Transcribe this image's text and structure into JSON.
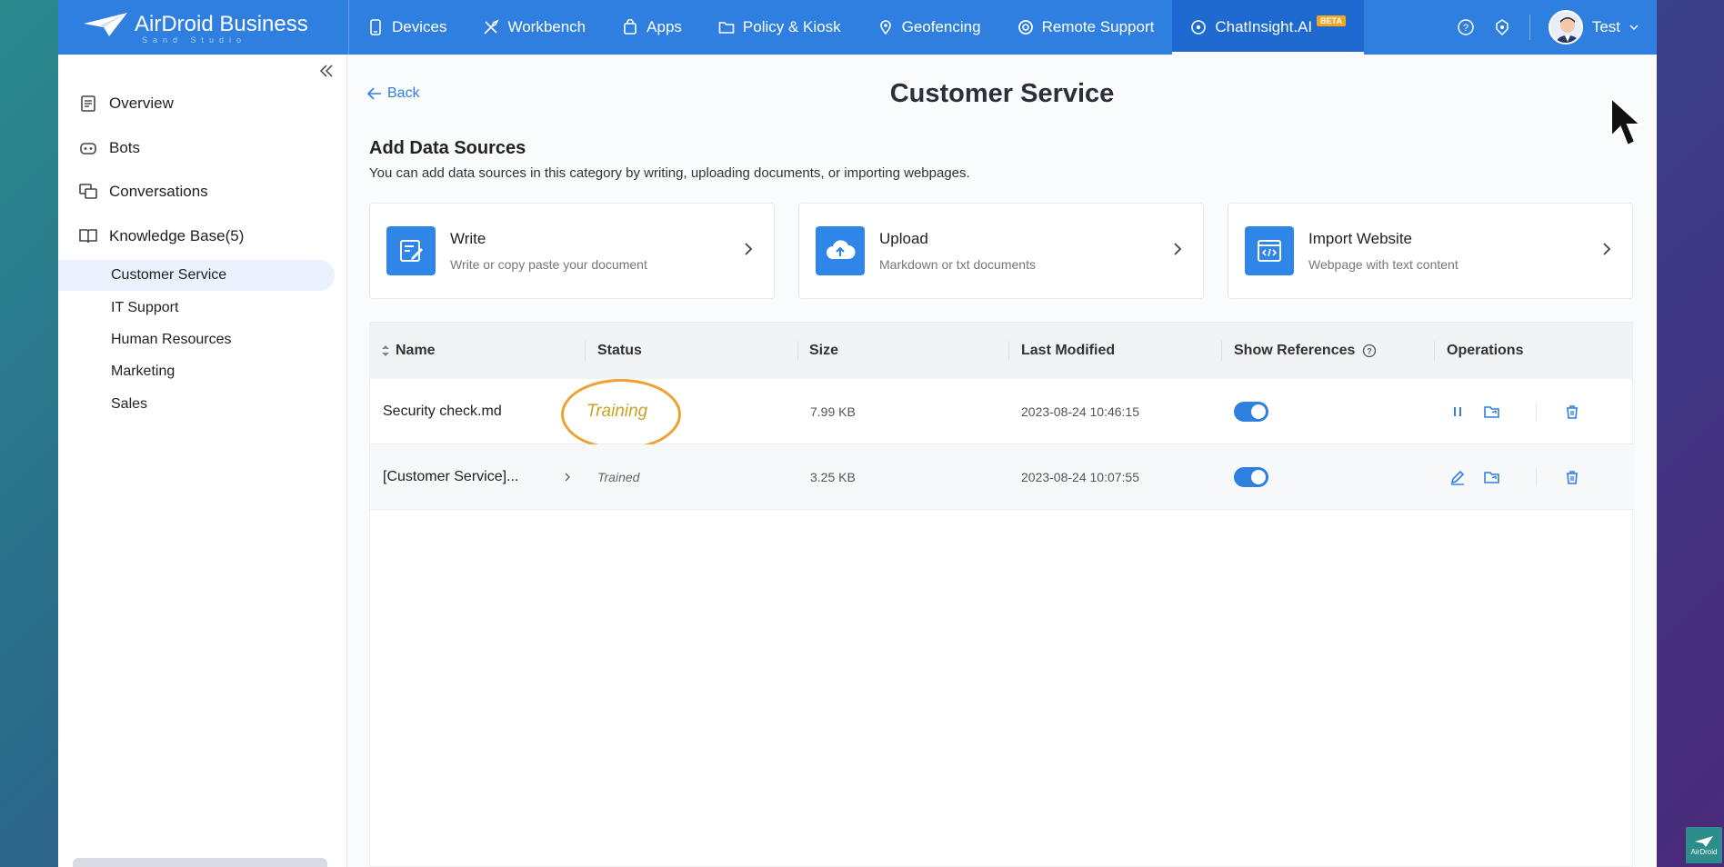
{
  "brand": {
    "name": "AirDroid Business",
    "sub": "Sand Studio"
  },
  "nav": [
    {
      "label": "Devices",
      "icon": "phone-icon"
    },
    {
      "label": "Workbench",
      "icon": "tools-icon"
    },
    {
      "label": "Apps",
      "icon": "bag-icon"
    },
    {
      "label": "Policy & Kiosk",
      "icon": "folder-icon"
    },
    {
      "label": "Geofencing",
      "icon": "map-pin-icon"
    },
    {
      "label": "Remote Support",
      "icon": "lifebuoy-icon"
    },
    {
      "label": "ChatInsight.AI",
      "icon": "chat-ai-icon",
      "badge": "BETA",
      "active": true
    }
  ],
  "user": {
    "name": "Test"
  },
  "sidebar": {
    "items": [
      {
        "label": "Overview",
        "icon": "document-icon"
      },
      {
        "label": "Bots",
        "icon": "robot-icon"
      },
      {
        "label": "Conversations",
        "icon": "chat-bubbles-icon"
      },
      {
        "label": "Knowledge Base(5)",
        "icon": "book-icon"
      }
    ],
    "sub_items": [
      "Customer Service",
      "IT Support",
      "Human Resources",
      "Marketing",
      "Sales"
    ],
    "active_sub": "Customer Service"
  },
  "main": {
    "back_label": "Back",
    "title": "Customer Service",
    "section_title": "Add Data Sources",
    "section_desc": "You can add data sources in this category by writing, uploading documents, or importing webpages.",
    "cards": [
      {
        "title": "Write",
        "sub": "Write or copy paste your document",
        "icon": "write-icon"
      },
      {
        "title": "Upload",
        "sub": "Markdown or txt documents",
        "icon": "cloud-upload-icon"
      },
      {
        "title": "Import Website",
        "sub": "Webpage with text content",
        "icon": "code-window-icon"
      }
    ]
  },
  "table": {
    "headers": [
      "Name",
      "Status",
      "Size",
      "Last Modified",
      "Show References",
      "Operations"
    ],
    "rows": [
      {
        "name": "Security check.md",
        "status": "Training",
        "size": "7.99 KB",
        "modified": "2023-08-24 10:46:15",
        "show_refs": true
      },
      {
        "name": "[Customer Service]...",
        "status": "Trained",
        "size": "3.25 KB",
        "modified": "2023-08-24 10:07:55",
        "show_refs": true
      }
    ]
  },
  "colors": {
    "primary": "#2f7fe0",
    "highlight": "#f0a030",
    "training": "#c9a227"
  },
  "watermark": "AirDroid"
}
